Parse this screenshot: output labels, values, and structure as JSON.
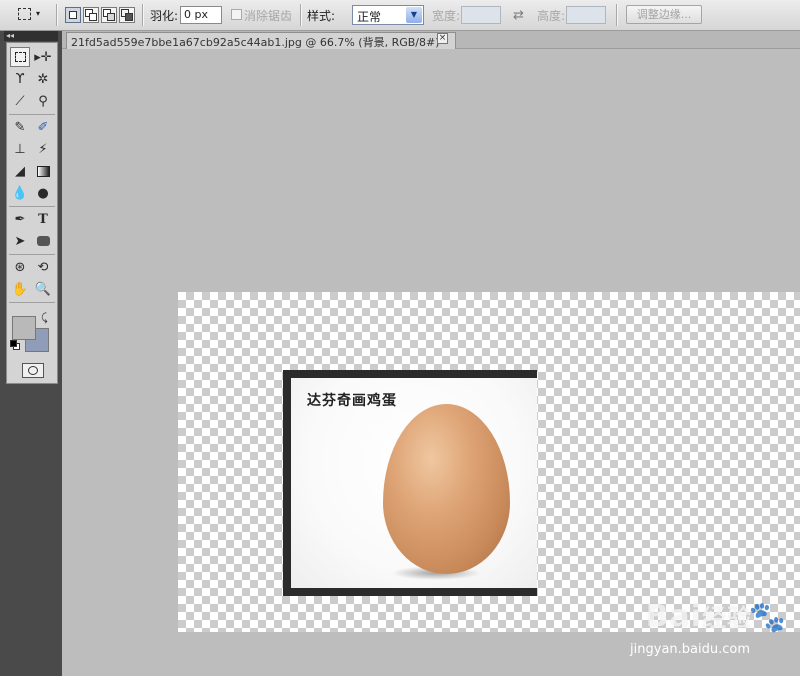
{
  "options_bar": {
    "feather_label": "羽化:",
    "feather_value": "0 px",
    "antialias_label": "消除锯齿",
    "style_label": "样式:",
    "style_value": "正常",
    "width_label": "宽度:",
    "height_label": "高度:",
    "refine_edge_label": "调整边缘..."
  },
  "document": {
    "tab_title": "21fd5ad559e7bbe1a67cb92a5c44ab1.jpg @ 66.7% (背景, RGB/8#) *",
    "close_glyph": "×"
  },
  "photo": {
    "caption": "达芬奇画鸡蛋"
  },
  "toolbox": {
    "collapse_glyph": "◂◂",
    "foreground_color": "#b9b9b9",
    "background_color": "#8f9db8"
  },
  "watermark": {
    "brand": "Bai",
    "brand_suffix": "经验",
    "url": "jingyan.baidu.com"
  }
}
